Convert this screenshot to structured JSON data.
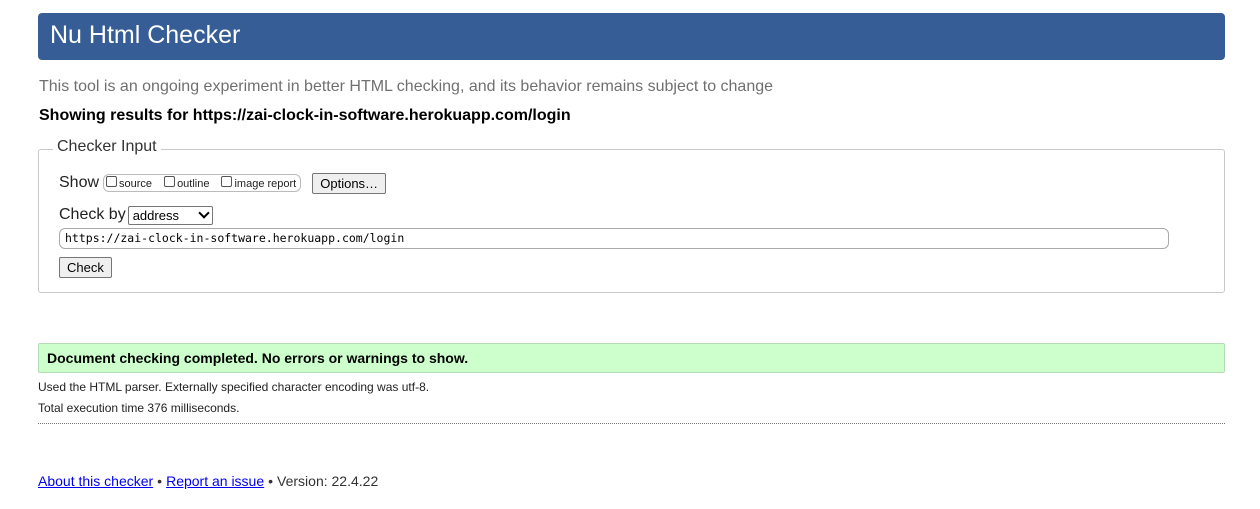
{
  "header": {
    "title": "Nu Html Checker"
  },
  "tagline": "This tool is an ongoing experiment in better HTML checking, and its behavior remains subject to change",
  "results_heading": "Showing results for https://zai-clock-in-software.herokuapp.com/login",
  "checker_input": {
    "legend": "Checker Input",
    "show_label": "Show",
    "show_options": [
      {
        "label": "source",
        "checked": false
      },
      {
        "label": "outline",
        "checked": false
      },
      {
        "label": "image report",
        "checked": false
      }
    ],
    "options_button": "Options…",
    "check_by_label": "Check by",
    "check_by_value": "address",
    "url_value": "https://zai-clock-in-software.herokuapp.com/login",
    "check_button": "Check"
  },
  "result": {
    "success_message": "Document checking completed. No errors or warnings to show.",
    "parser_note": "Used the HTML parser. Externally specified character encoding was utf-8.",
    "execution_time": "Total execution time 376 milliseconds."
  },
  "footer": {
    "about_link": "About this checker",
    "separator": "•",
    "report_link": "Report an issue",
    "version": "Version: 22.4.22"
  },
  "colors": {
    "header_bg": "#365d95",
    "success_bg": "#ccffcc",
    "link": "#0000ee"
  }
}
